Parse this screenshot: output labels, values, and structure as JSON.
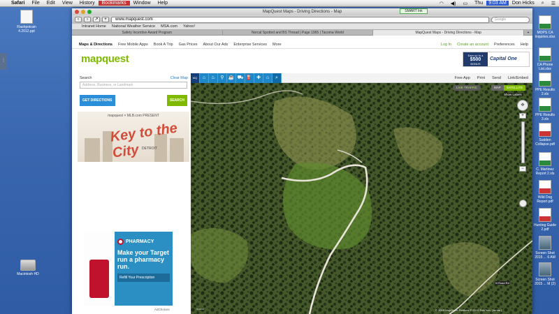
{
  "menubar": {
    "app": "Safari",
    "items": [
      "File",
      "Edit",
      "View",
      "History",
      "Bookmarks",
      "Window",
      "Help"
    ],
    "day": "Thu",
    "time": "9:03 AM",
    "user": "Don Hicks"
  },
  "desktop": {
    "left_icons": [
      {
        "label": "Flashpotrain 4.2012.ppt",
        "type": "doc"
      },
      {
        "label": "Macintosh HD",
        "type": "hd"
      }
    ],
    "right_icons": [
      {
        "label": "MOPS CA Inquiries.xlsx",
        "type": "xls"
      },
      {
        "label": "CA Phone List.xlsx",
        "type": "xls"
      },
      {
        "label": "PPE Results 2.xls",
        "type": "xls"
      },
      {
        "label": "PPE Results 3.xls",
        "type": "xls"
      },
      {
        "label": "Sudden Collapse.pdf",
        "type": "pdf"
      },
      {
        "label": "C. Martinez Report 2.xls",
        "type": "xls"
      },
      {
        "label": "Wild Dog Report.pdf",
        "type": "pdf"
      },
      {
        "label": "Hunting Guide 2.pdf",
        "type": "pdf"
      },
      {
        "label": "Screen Shot 2015 ... 6 AM",
        "type": "shot"
      },
      {
        "label": "Screen Shot 2015 ... M (2)",
        "type": "shot"
      }
    ]
  },
  "browser": {
    "title": "MapQuest Maps - Driving Directions - Map",
    "url": "www.mapquest.com",
    "search_placeholder": "Google",
    "smart_ink": "SMART Ink",
    "bookmarks": [
      "Intranet Home",
      "National Weather Service",
      "MSA.com",
      "Yahoo!"
    ],
    "tabs": [
      "Safety Incentive Award Program",
      "Norcal Spotted and BS Thread | Page 1965 | Tacoma World",
      "MapQuest Maps - Driving Directions - Map"
    ]
  },
  "mapquest": {
    "nav": [
      "Maps & Directions",
      "Free Mobile Apps",
      "Book A Trip",
      "Gas Prices",
      "About Our Ads",
      "Enterprise Services",
      "More"
    ],
    "account": [
      "Log In",
      "Create an account",
      "Preferences",
      "Help"
    ],
    "logo": "mapquest",
    "ad": {
      "earn": "Earn up to a",
      "amount": "$500",
      "bonus": "BONUS",
      "brand": "Capital One"
    },
    "search_label": "Search",
    "clear_map": "Clear Map",
    "search_placeholder": "Address, Business, or Landmark",
    "get_directions": "GET DIRECTIONS",
    "search_button": "SEARCH",
    "promo": {
      "header": "mapquest × MLB.com PRESENT",
      "title": "Key to the City",
      "sub": "DETROIT"
    },
    "target_ad": {
      "brand": "PHARMACY",
      "headline": "Make your Target run a pharmacy run.",
      "cta": "Refill Your Prescription",
      "adchoices": "AdChoices"
    },
    "map_toolbar": [
      "Free App",
      "Print",
      "Send",
      "Link/Embed"
    ],
    "live_traffic": "LIVE TRAFFIC",
    "map_btn": "MAP",
    "satellite_btn": "SATELLITE",
    "show_labels": "Show Labels",
    "sign": "N Road Rd",
    "copyright": "© 2015 MapQuest  Portions © 2015 TomTom, | terms |"
  },
  "colors": {
    "accent": "#7fba00",
    "blue": "#2a8fd8",
    "target_red": "#c1122d"
  }
}
